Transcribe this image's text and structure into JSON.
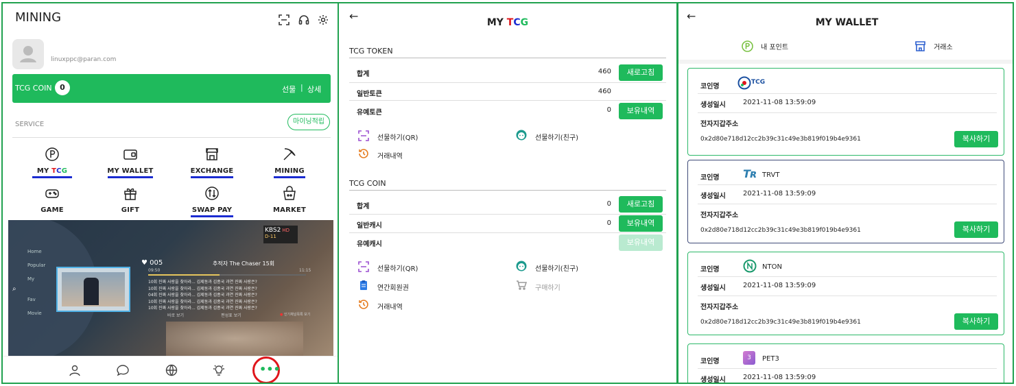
{
  "panel1": {
    "title": "MINING",
    "email": "linuxppc@paran.com",
    "coin_label": "TCG COIN",
    "coin_count": "0",
    "gift": "선물",
    "sep": "|",
    "detail": "상세",
    "service_label": "SERVICE",
    "mining_rewards_button": "마이닝적립",
    "services": [
      {
        "label": "MY TCG",
        "icon": "p-circle-icon"
      },
      {
        "label": "MY WALLET",
        "icon": "wallet-icon"
      },
      {
        "label": "EXCHANGE",
        "icon": "store-icon"
      },
      {
        "label": "MINING",
        "icon": "pickaxe-icon"
      },
      {
        "label": "GAME",
        "icon": "gamepad-icon"
      },
      {
        "label": "GIFT",
        "icon": "gift-icon"
      },
      {
        "label": "SWAP PAY",
        "icon": "swap-icon"
      },
      {
        "label": "MARKET",
        "icon": "basket-icon"
      }
    ],
    "banner": {
      "channel": "KBS2",
      "channel_sub": "HD",
      "show_badge": "D-11",
      "episode_num": "005",
      "episode_title": "추적자 The Chaser 15회",
      "time_start": "09:50",
      "time_end": "11:15",
      "desc_lines": [
        "10회 진짜 사랑을 찾아라... 김제동과 김종국 과연 진짜 사랑은?",
        "10회 진짜 사랑을 찾아라... 김제동과 김종국 과연 진짜 사랑은?",
        "04회 진짜 사랑을 찾아라... 김제동과 김종국 과연 진짜 사랑은?",
        "10회 진짜 사랑을 찾아라... 김제동과 김종국 과연 진짜 사랑은?",
        "10회 진짜 사랑을 찾아라... 김제동과 김종국 과연 진짜 사랑은?"
      ],
      "menu_items": [
        "Home",
        "Popular",
        "My",
        "Fav",
        "Movie"
      ],
      "btn_watch": "바로 보기",
      "btn_record": "편성표 보기",
      "btn_channel": "인기채널목록 보기"
    }
  },
  "panel2": {
    "title_prefix": "MY ",
    "title_t": "T",
    "title_c": "C",
    "title_g": "G",
    "token_section": "TCG TOKEN",
    "token_rows": [
      {
        "label": "합계",
        "value": "460",
        "button": "새로고침"
      },
      {
        "label": "일반토큰",
        "value": "460",
        "button": ""
      },
      {
        "label": "유예토큰",
        "value": "0",
        "button": "보유내역"
      }
    ],
    "token_actions": {
      "gift_qr": "선물하기(QR)",
      "gift_friend": "선물하기(친구)",
      "history": "거래내역"
    },
    "coin_section": "TCG COIN",
    "coin_rows": [
      {
        "label": "합계",
        "value": "0",
        "button": "새로고침"
      },
      {
        "label": "일반캐시",
        "value": "0",
        "button": "보유내역"
      },
      {
        "label": "유예캐시",
        "value": "",
        "button": "보유내역"
      }
    ],
    "coin_actions": {
      "gift_qr": "선물하기(QR)",
      "gift_friend": "선물하기(친구)",
      "membership": "연간회원권",
      "buy": "구매하기",
      "history": "거래내역"
    }
  },
  "panel3": {
    "title": "MY WALLET",
    "tab_points": "내 포인트",
    "tab_exchange": "거래소",
    "labels": {
      "coin": "코인명",
      "created": "생성일시",
      "address": "전자지갑주소",
      "copy": "복사하기"
    },
    "cards": [
      {
        "coin": "TCG",
        "date": "2021-11-08 13:59:09",
        "address": "0x2d80e718d12cc2b39c31c49e3b819f019b4e9361"
      },
      {
        "coin": "TRVT",
        "date": "2021-11-08 13:59:09",
        "address": "0x2d80e718d12cc2b39c31c49e3b819f019b4e9361"
      },
      {
        "coin": "NTON",
        "date": "2021-11-08 13:59:09",
        "address": "0x2d80e718d12cc2b39c31c49e3b819f019b4e9361"
      },
      {
        "coin": "PET3",
        "date": "2021-11-08 13:59:09",
        "address": ""
      }
    ]
  },
  "colors": {
    "green": "#1fba5c",
    "frame": "#1fa14e",
    "underline": "#1a2bd1",
    "highlight_ring": "#e0151b"
  }
}
